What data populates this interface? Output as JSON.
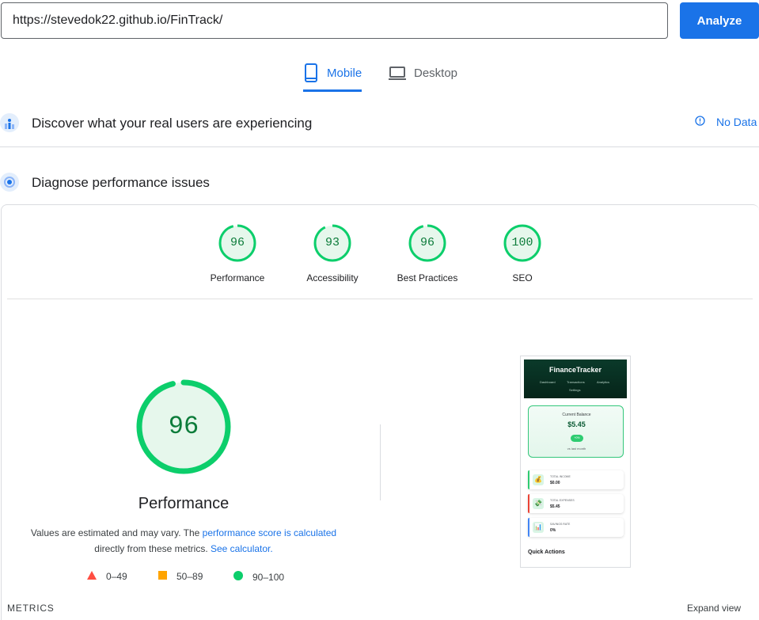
{
  "search": {
    "url": "https://stevedok22.github.io/FinTrack/",
    "analyze_label": "Analyze"
  },
  "tabs": {
    "mobile": "Mobile",
    "desktop": "Desktop"
  },
  "sections": {
    "real_users": "Discover what your real users are experiencing",
    "no_data": "No Data",
    "diagnose": "Diagnose performance issues"
  },
  "scores": [
    {
      "label": "Performance",
      "value": "96"
    },
    {
      "label": "Accessibility",
      "value": "93"
    },
    {
      "label": "Best Practices",
      "value": "96"
    },
    {
      "label": "SEO",
      "value": "100"
    }
  ],
  "performance": {
    "score": "96",
    "title": "Performance",
    "desc_prefix": "Values are estimated and may vary. The ",
    "desc_link1": "performance score is calculated",
    "desc_middle": "directly from these metrics.",
    "desc_link2": "See calculator."
  },
  "legend": {
    "poor": "0–49",
    "average": "50–89",
    "good": "90–100"
  },
  "colors": {
    "accent": "#1a73e8",
    "good": "#0cce6b",
    "average": "#ffa400",
    "poor": "#ff4e42"
  },
  "footer": {
    "metrics": "METRICS",
    "expand": "Expand view"
  },
  "phone": {
    "brand": "FinanceTracker",
    "nav": [
      "Dashboard",
      "Transactions",
      "Analytics",
      "Settings"
    ],
    "balance_label": "Current Balance",
    "balance_value": "$5.45",
    "balance_pill": "+0%",
    "balance_vs": "vs last month",
    "stats": [
      {
        "title": "TOTAL INCOME",
        "value": "$0.00",
        "icon": "💰"
      },
      {
        "title": "TOTAL EXPENSES",
        "value": "$5.45",
        "icon": "💸"
      },
      {
        "title": "SAVINGS RATE",
        "value": "0%",
        "icon": "📊"
      }
    ],
    "quick_actions": "Quick Actions"
  }
}
